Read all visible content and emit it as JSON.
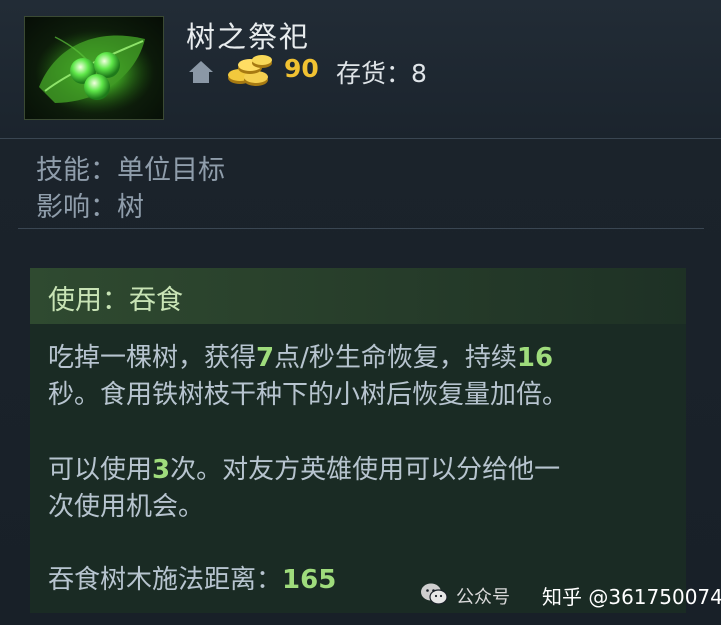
{
  "item": {
    "name": "树之祭祀",
    "gold_cost": "90",
    "stock_label": "存货：",
    "stock_value": "8"
  },
  "properties": {
    "skill_line": "技能：单位目标",
    "affects_line": "影响：树"
  },
  "ability": {
    "title": "使用：吞食",
    "para1": {
      "pre1": "吃掉一棵树，获得",
      "hl1": "7",
      "mid1": "点/秒生命恢复，持续",
      "hl2": "16",
      "line2": "秒。食用铁树枝干种下的小树后恢复量加倍。"
    },
    "para2": {
      "pre1": "可以使用",
      "hl1": "3",
      "post1": "次。对友方英雄使用可以分给他一",
      "line2": "次使用机会。"
    },
    "para3": {
      "label": "吞食树木施法距离：",
      "value": "165"
    }
  },
  "watermark": {
    "account": "公众号",
    "site": "知乎 @361750074"
  },
  "colors": {
    "gold": "#f1c232",
    "highlight": "#9fdc7c",
    "ability_header": "#2f4a30"
  },
  "icons": [
    "tango-item-icon",
    "shop-home-icon",
    "gold-coins-icon",
    "wechat-icon"
  ]
}
